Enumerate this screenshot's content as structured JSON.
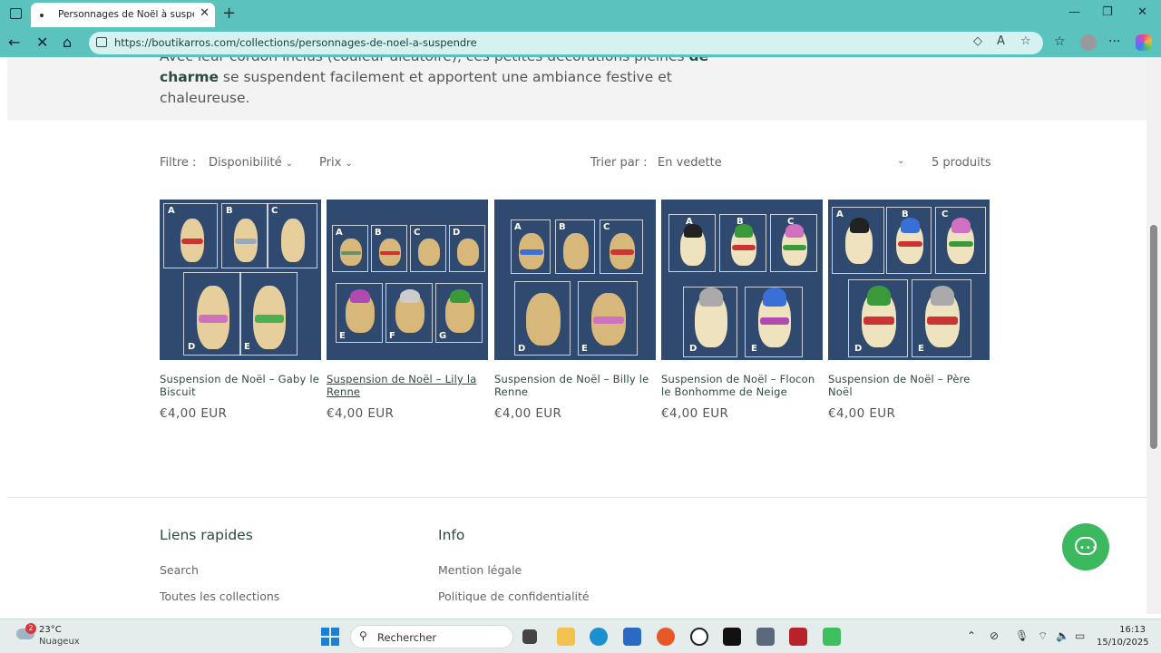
{
  "browser": {
    "tab_title": "Personnages de Noël à suspendre",
    "url": "https://boutikarros.com/collections/personnages-de-noel-a-suspendre"
  },
  "banner": {
    "line0": "Avec leur cordon inclus (couleur aléatoire), ces petites décorations pleines",
    "bold": "de charme",
    "rest": " se suspendent facilement et apportent une ambiance festive et chaleureuse."
  },
  "filters": {
    "label": "Filtre :",
    "availability": "Disponibilité",
    "price": "Prix",
    "sort_label": "Trier par :",
    "sort_value": "En vedette",
    "count": "5 produits"
  },
  "products": [
    {
      "name": "Suspension de Noël – Gaby le Biscuit",
      "price": "€4,00 EUR"
    },
    {
      "name": "Suspension de Noël – Lily la Renne",
      "price": "€4,00 EUR"
    },
    {
      "name": "Suspension de Noël – Billy le Renne",
      "price": "€4,00 EUR"
    },
    {
      "name": "Suspension de Noël – Flocon le Bonhomme de Neige",
      "price": "€4,00 EUR"
    },
    {
      "name": "Suspension de Noël – Père Noël",
      "price": "€4,00 EUR"
    }
  ],
  "footer": {
    "col1_title": "Liens rapides",
    "col1_links": [
      "Search",
      "Toutes les collections"
    ],
    "col2_title": "Info",
    "col2_links": [
      "Mention légale",
      "Politique de confidentialité"
    ]
  },
  "taskbar": {
    "temp": "23°C",
    "weather": "Nuageux",
    "badge": "2",
    "search": "Rechercher",
    "time": "16:13",
    "date": "15/10/2025"
  },
  "colors": {
    "accent": "#5bc2bd",
    "chat": "#3cb85f",
    "product_bg": "#2f4a6e"
  }
}
